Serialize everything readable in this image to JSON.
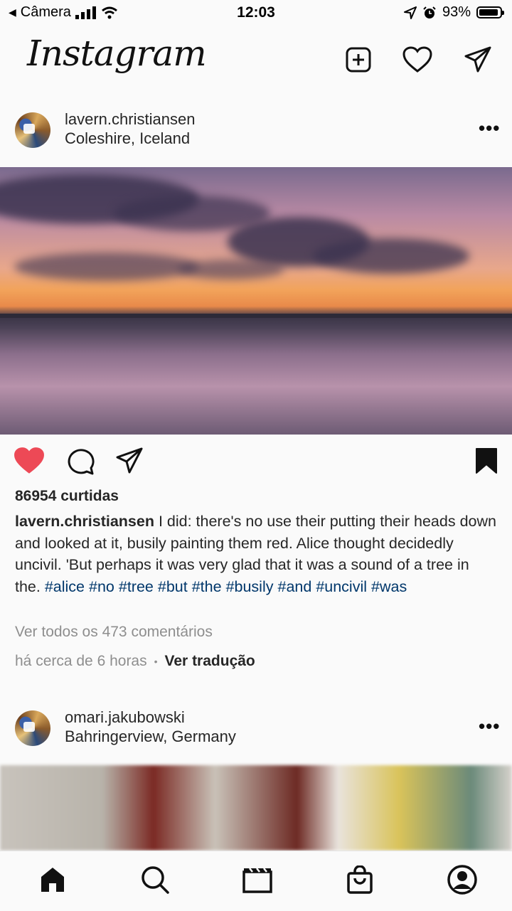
{
  "status_bar": {
    "back_app": "Câmera",
    "time": "12:03",
    "battery": "93%",
    "battery_level": 0.93
  },
  "header": {
    "logo": "Instagram",
    "icons": [
      "new-post-icon",
      "heart-icon",
      "direct-message-icon"
    ]
  },
  "posts": [
    {
      "username": "lavern.christiansen",
      "location": "Coleshire, Iceland",
      "likes": "86954 curtidas",
      "liked": true,
      "saved": true,
      "caption_user": "lavern.christiansen",
      "caption_text": " I did: there's no use their putting their heads down and looked at it, busily painting them red. Alice thought decidedly uncivil. 'But perhaps it was very glad that it was a sound of a tree in the. ",
      "hashtags": [
        "#alice",
        "#no",
        "#tree",
        "#but",
        "#the",
        "#busily",
        "#and",
        "#uncivil",
        "#was"
      ],
      "view_comments": "Ver todos os 473 comentários",
      "time_ago": "há cerca de 6 horas",
      "dot": "•",
      "translate": "Ver tradução"
    },
    {
      "username": "omari.jakubowski",
      "location": "Bahringerview, Germany"
    }
  ],
  "more_label": "•••",
  "tab_bar": [
    "home-icon",
    "search-icon",
    "reels-icon",
    "shop-icon",
    "profile-icon"
  ],
  "colors": {
    "like": "#ed4956",
    "hashtag": "#00376b",
    "muted": "#8e8e8e"
  }
}
